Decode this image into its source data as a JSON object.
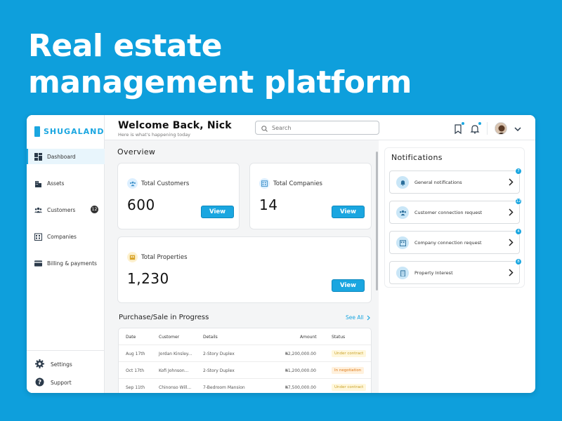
{
  "hero": {
    "line1": "Real estate",
    "line2": "management platform"
  },
  "brand": {
    "name": "SHUGALAND",
    "accent": "#1aa6e0"
  },
  "sidebar": {
    "items": [
      {
        "label": "Dashboard",
        "icon": "dashboard-icon",
        "active": true
      },
      {
        "label": "Assets",
        "icon": "building-icon"
      },
      {
        "label": "Customers",
        "icon": "users-icon",
        "badge": "12"
      },
      {
        "label": "Companies",
        "icon": "company-icon"
      },
      {
        "label": "Billing & payments",
        "icon": "card-icon"
      }
    ],
    "bottom": [
      {
        "label": "Settings",
        "icon": "gear-icon"
      },
      {
        "label": "Support",
        "icon": "help-icon"
      }
    ]
  },
  "header": {
    "welcome": "Welcome Back, Nick",
    "subtitle": "Here is what's happening today",
    "search_placeholder": "Search"
  },
  "overview": {
    "title": "Overview",
    "cards": [
      {
        "label": "Total Customers",
        "value": "600",
        "button": "View"
      },
      {
        "label": "Total Companies",
        "value": "14",
        "button": "View"
      },
      {
        "label": "Total Properties",
        "value": "1,230",
        "button": "View"
      }
    ]
  },
  "purchase_sale": {
    "title": "Purchase/Sale in Progress",
    "see_all": "See All",
    "columns": [
      "Date",
      "Customer",
      "Details",
      "Amount",
      "Status"
    ],
    "rows": [
      {
        "date": "Aug 17th",
        "customer": "Jordan Kinsley...",
        "details": "2-Story Duplex",
        "amount": "₦2,200,000.00",
        "status": "Under contract",
        "status_color": "#c9a227"
      },
      {
        "date": "Oct 17th",
        "customer": "Kofi Johnson...",
        "details": "2-Story Duplex",
        "amount": "₦1,200,000.00",
        "status": "In negotiation",
        "status_color": "#e07b1a"
      },
      {
        "date": "Sep 11th",
        "customer": "Chinonso Will...",
        "details": "7-Bedroom Mansion",
        "amount": "₦7,500,000.00",
        "status": "Under contract",
        "status_color": "#c9a227"
      }
    ]
  },
  "notifications": {
    "title": "Notifications",
    "items": [
      {
        "label": "General notifications",
        "badge": "7",
        "icon": "bell-icon"
      },
      {
        "label": "Customer connection request",
        "badge": "12",
        "icon": "users-icon"
      },
      {
        "label": "Company connection request",
        "badge": "4",
        "icon": "company-icon"
      },
      {
        "label": "Property Interest",
        "badge": "8",
        "icon": "building-icon"
      }
    ]
  }
}
